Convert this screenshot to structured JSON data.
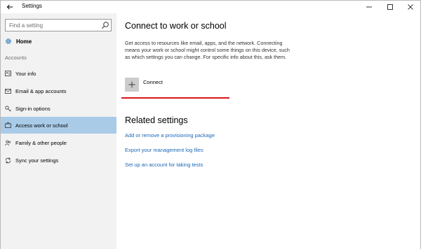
{
  "window": {
    "title": "Settings",
    "back_icon": "arrow-left-icon",
    "minimize_icon": "minimize-icon",
    "maximize_icon": "maximize-icon",
    "close_icon": "close-icon"
  },
  "sidebar": {
    "search": {
      "value": "",
      "placeholder": "Find a setting",
      "icon": "search-icon"
    },
    "home": {
      "label": "Home",
      "icon": "gear-icon"
    },
    "section_label": "Accounts",
    "items": [
      {
        "label": "Your info",
        "icon": "contact-card-icon",
        "active": false
      },
      {
        "label": "Email & app accounts",
        "icon": "mail-icon",
        "active": false
      },
      {
        "label": "Sign-in options",
        "icon": "key-icon",
        "active": false
      },
      {
        "label": "Access work or school",
        "icon": "briefcase-icon",
        "active": true
      },
      {
        "label": "Family & other people",
        "icon": "people-icon",
        "active": false
      },
      {
        "label": "Sync your settings",
        "icon": "sync-icon",
        "active": false
      }
    ],
    "active_color": "#a9cbe8",
    "background_color": "#f2f2f2"
  },
  "main": {
    "title": "Connect to work or school",
    "description": "Get access to resources like email, apps, and the network. Connecting means your work or school might control some things on this device, such as which settings you can change. For specific info about this, ask them.",
    "connect": {
      "label": "Connect",
      "icon": "plus-icon"
    },
    "annotation_color": "#d9151b",
    "related": {
      "title": "Related settings",
      "links": [
        "Add or remove a provisioning package",
        "Export your management log files",
        "Set up an account for taking tests"
      ],
      "link_color": "#1a67b8"
    }
  }
}
